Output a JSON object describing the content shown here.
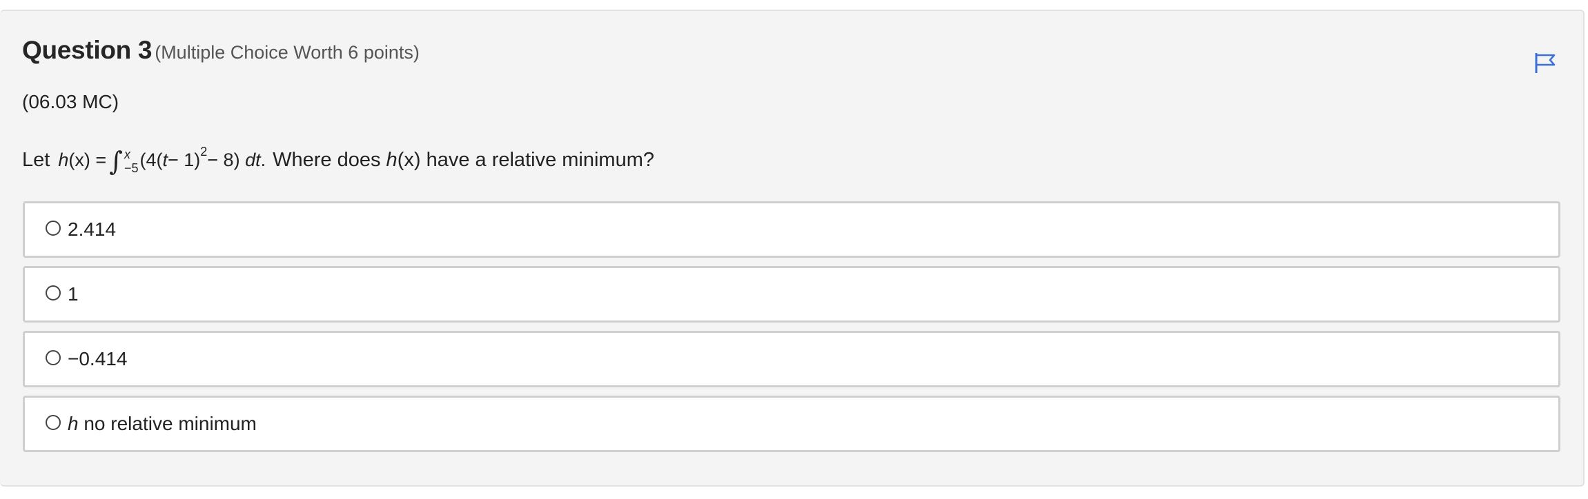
{
  "question": {
    "title": "Question 3",
    "meta": "(Multiple Choice Worth 6 points)",
    "code": "(06.03 MC)",
    "prompt_prefix": "Let",
    "formula": {
      "lhs_func": "h",
      "lhs_arg": "(x) =",
      "upper_limit": "x",
      "lower_limit": "−5",
      "integrand_a": "(4(",
      "integrand_t": "t",
      "integrand_b": " − 1)",
      "exponent": "2",
      "integrand_c": " − 8)",
      "differential": "dt",
      "end": "."
    },
    "prompt_suffix_1": "Where does",
    "prompt_func": "h",
    "prompt_arg": "(x)",
    "prompt_suffix_2": "have a relative minimum?"
  },
  "flag": {
    "icon": "flag-icon",
    "color": "#3a6fd8"
  },
  "options": [
    {
      "label": "2.414"
    },
    {
      "label": "1"
    },
    {
      "label": "−0.414"
    },
    {
      "label_italic": "h",
      "label": " no relative minimum"
    }
  ]
}
